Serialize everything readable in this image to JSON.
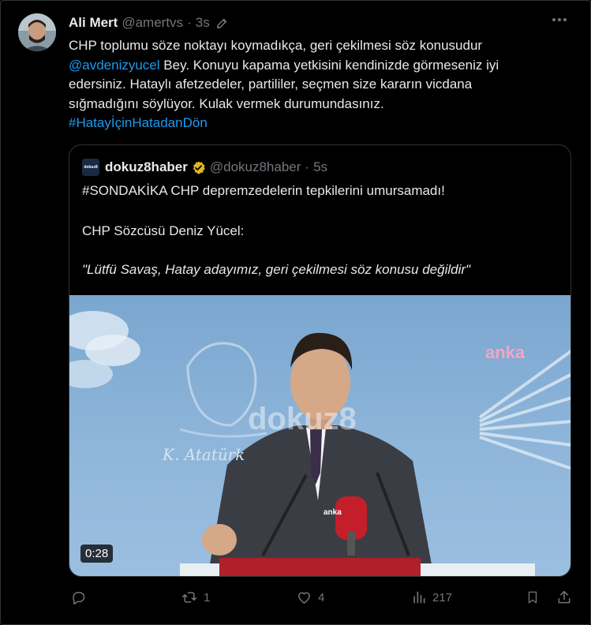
{
  "tweet": {
    "author_name": "Ali Mert",
    "author_handle": "@amertvs",
    "separator": "·",
    "time": "3s",
    "text_lines": [
      "CHP toplumu söze noktayı koymadıkça, geri çekilmesi söz konusudur",
      "Bey. Konuyu kapama yetkisini kendinizde görmeseniz iyi",
      "edersiniz. Hataylı afetzedeler, partililer, seçmen size kararın vicdana",
      "sığmadığını söylüyor. Kulak vermek durumundasınız."
    ],
    "mention": "@avdenizyucel",
    "hashtag": "#HatayİçinHatadanDön"
  },
  "quote": {
    "logo_text": "dokuz8",
    "author_name": "dokuz8haber",
    "author_handle": "@dokuz8haber",
    "separator": "·",
    "time": "5s",
    "line1": "#SONDAKİKA CHP depremzedelerin tepkilerini umursamadı!",
    "line2": "CHP Sözcüsü Deniz Yücel:",
    "line3": "\"Lütfü Savaş, Hatay adayımız, geri çekilmesi söz konusu değildir\"",
    "video": {
      "watermark": "dokuz8",
      "channel_logo": "anka",
      "mic_label": "anka",
      "signature": "K. Atatürk",
      "duration": "0:28"
    }
  },
  "actions": {
    "reply_count": "",
    "retweet_count": "1",
    "like_count": "4",
    "views_count": "217"
  },
  "colors": {
    "background": "#000000",
    "text": "#e7e9ea",
    "secondary": "#71767b",
    "link": "#1d9bf0",
    "border": "#2f3336",
    "verified_gold": "#e2b719"
  }
}
